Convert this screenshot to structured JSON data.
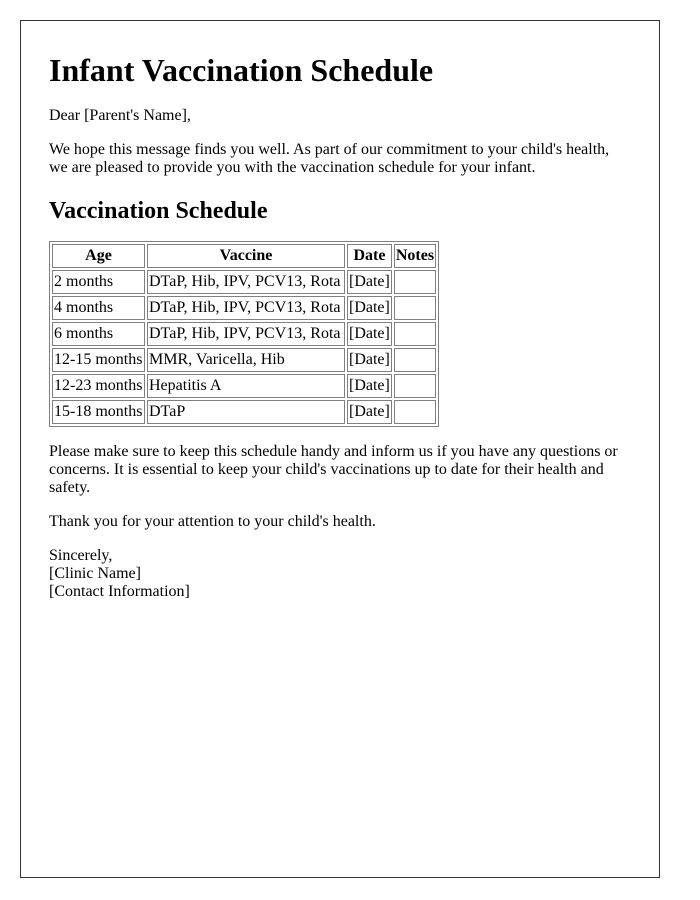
{
  "document": {
    "title": "Infant Vaccination Schedule",
    "greeting": "Dear [Parent's Name],",
    "intro": "We hope this message finds you well. As part of our commitment to your child's health, we are pleased to provide you with the vaccination schedule for your infant.",
    "section_heading": "Vaccination Schedule",
    "table": {
      "headers": [
        "Age",
        "Vaccine",
        "Date",
        "Notes"
      ],
      "rows": [
        {
          "age": "2 months",
          "vaccine": "DTaP, Hib, IPV, PCV13, Rota",
          "date": "[Date]",
          "notes": ""
        },
        {
          "age": "4 months",
          "vaccine": "DTaP, Hib, IPV, PCV13, Rota",
          "date": "[Date]",
          "notes": ""
        },
        {
          "age": "6 months",
          "vaccine": "DTaP, Hib, IPV, PCV13, Rota",
          "date": "[Date]",
          "notes": ""
        },
        {
          "age": "12-15 months",
          "vaccine": "MMR, Varicella, Hib",
          "date": "[Date]",
          "notes": ""
        },
        {
          "age": "12-23 months",
          "vaccine": "Hepatitis A",
          "date": "[Date]",
          "notes": ""
        },
        {
          "age": "15-18 months",
          "vaccine": "DTaP",
          "date": "[Date]",
          "notes": ""
        }
      ]
    },
    "reminder": "Please make sure to keep this schedule handy and inform us if you have any questions or concerns. It is essential to keep your child's vaccinations up to date for their health and safety.",
    "thanks": "Thank you for your attention to your child's health.",
    "signoff": "Sincerely,",
    "clinic_name": "[Clinic Name]",
    "contact_info": "[Contact Information]"
  }
}
